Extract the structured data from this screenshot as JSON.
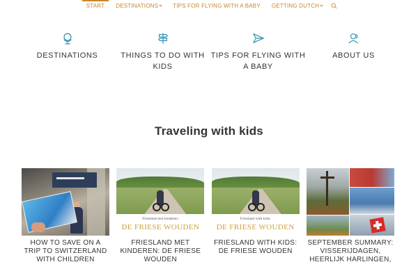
{
  "nav": {
    "items": [
      {
        "label": "START",
        "active": true,
        "has_dropdown": false
      },
      {
        "label": "DESTINATIONS",
        "active": false,
        "has_dropdown": true
      },
      {
        "label": "TIPS FOR FLYING WITH A BABY",
        "active": false,
        "has_dropdown": false
      },
      {
        "label": "GETTING DUTCH",
        "active": false,
        "has_dropdown": true
      }
    ],
    "search_icon": "search-icon"
  },
  "features": [
    {
      "icon": "globe-icon",
      "label": "DESTINATIONS"
    },
    {
      "icon": "signpost-icon",
      "label": "THINGS TO DO WITH KIDS"
    },
    {
      "icon": "paper-plane-icon",
      "label": "TIPS FOR FLYING WITH A BABY"
    },
    {
      "icon": "people-icon",
      "label": "ABOUT US"
    }
  ],
  "section_title": "Traveling with kids",
  "posts": [
    {
      "title": "HOW TO SAVE ON A TRIP TO SWITZERLAND WITH CHILDREN"
    },
    {
      "title": "FRIESLAND MET KINDEREN: DE FRIESE WOUDEN",
      "thumb_sub": "Friesland met kinderen:",
      "thumb_big": "DE FRIESE WOUDEN"
    },
    {
      "title": "FRIESLAND WITH KIDS: DE FRIESE WOUDEN",
      "thumb_sub": "Friesland with kids:",
      "thumb_big": "DE FRIESE WOUDEN"
    },
    {
      "title": "SEPTEMBER SUMMARY: VISSERIJDAGEN, HEERLIJK HARLINGEN,"
    }
  ],
  "colors": {
    "accent": "#c8872a",
    "icon": "#2a8fb0",
    "text": "#333333"
  }
}
